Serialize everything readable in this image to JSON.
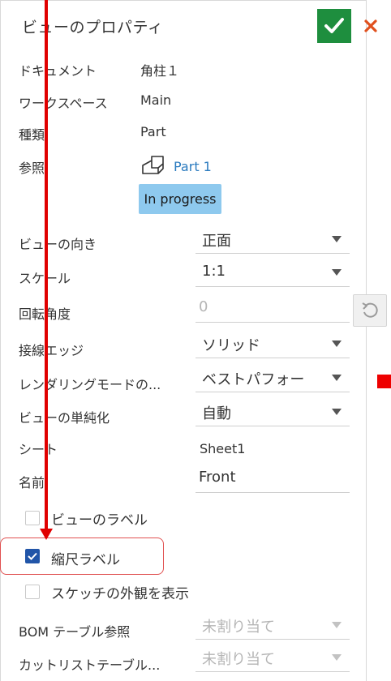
{
  "panel": {
    "title": "ビューのプロパティ",
    "ok_icon": "check-icon",
    "cancel_icon": "close-icon"
  },
  "info": {
    "document_label": "ドキュメント",
    "document_value": "角柱１",
    "workspace_label": "ワークスペース",
    "workspace_value": "Main",
    "type_label": "種類",
    "type_value": "Part",
    "reference_label": "参照",
    "reference_value": "Part 1",
    "reference_icon": "part-icon",
    "status_badge": "In progress"
  },
  "fields": {
    "orientation_label": "ビューの向き",
    "orientation_value": "正面",
    "scale_label": "スケール",
    "scale_value": "1:1",
    "rotation_label": "回転角度",
    "rotation_value": "0",
    "tangent_label": "接線エッジ",
    "tangent_value": "ソリッド",
    "render_label": "レンダリングモードの...",
    "render_value": "ベストパフォー",
    "simplify_label": "ビューの単純化",
    "simplify_value": "自動",
    "sheet_label": "シート",
    "sheet_value": "Sheet1",
    "name_label": "名前",
    "name_value": "Front"
  },
  "checkboxes": {
    "view_label": "ビューのラベル",
    "view_label_checked": false,
    "scale_label": "縮尺ラベル",
    "scale_label_checked": true,
    "sketch_label": "スケッチの外観を表示",
    "sketch_label_checked": false
  },
  "bottom": {
    "bom_label": "BOM テーブル参照",
    "bom_value": "未割り当て",
    "cutlist_label": "カットリストテーブル...",
    "cutlist_value": "未割り当て"
  },
  "colors": {
    "accent_ok": "#1e8e3e",
    "cancel": "#e0501e",
    "badge": "#8ec9ee",
    "link": "#2b7bbf",
    "annotation_red": "#e00000"
  }
}
